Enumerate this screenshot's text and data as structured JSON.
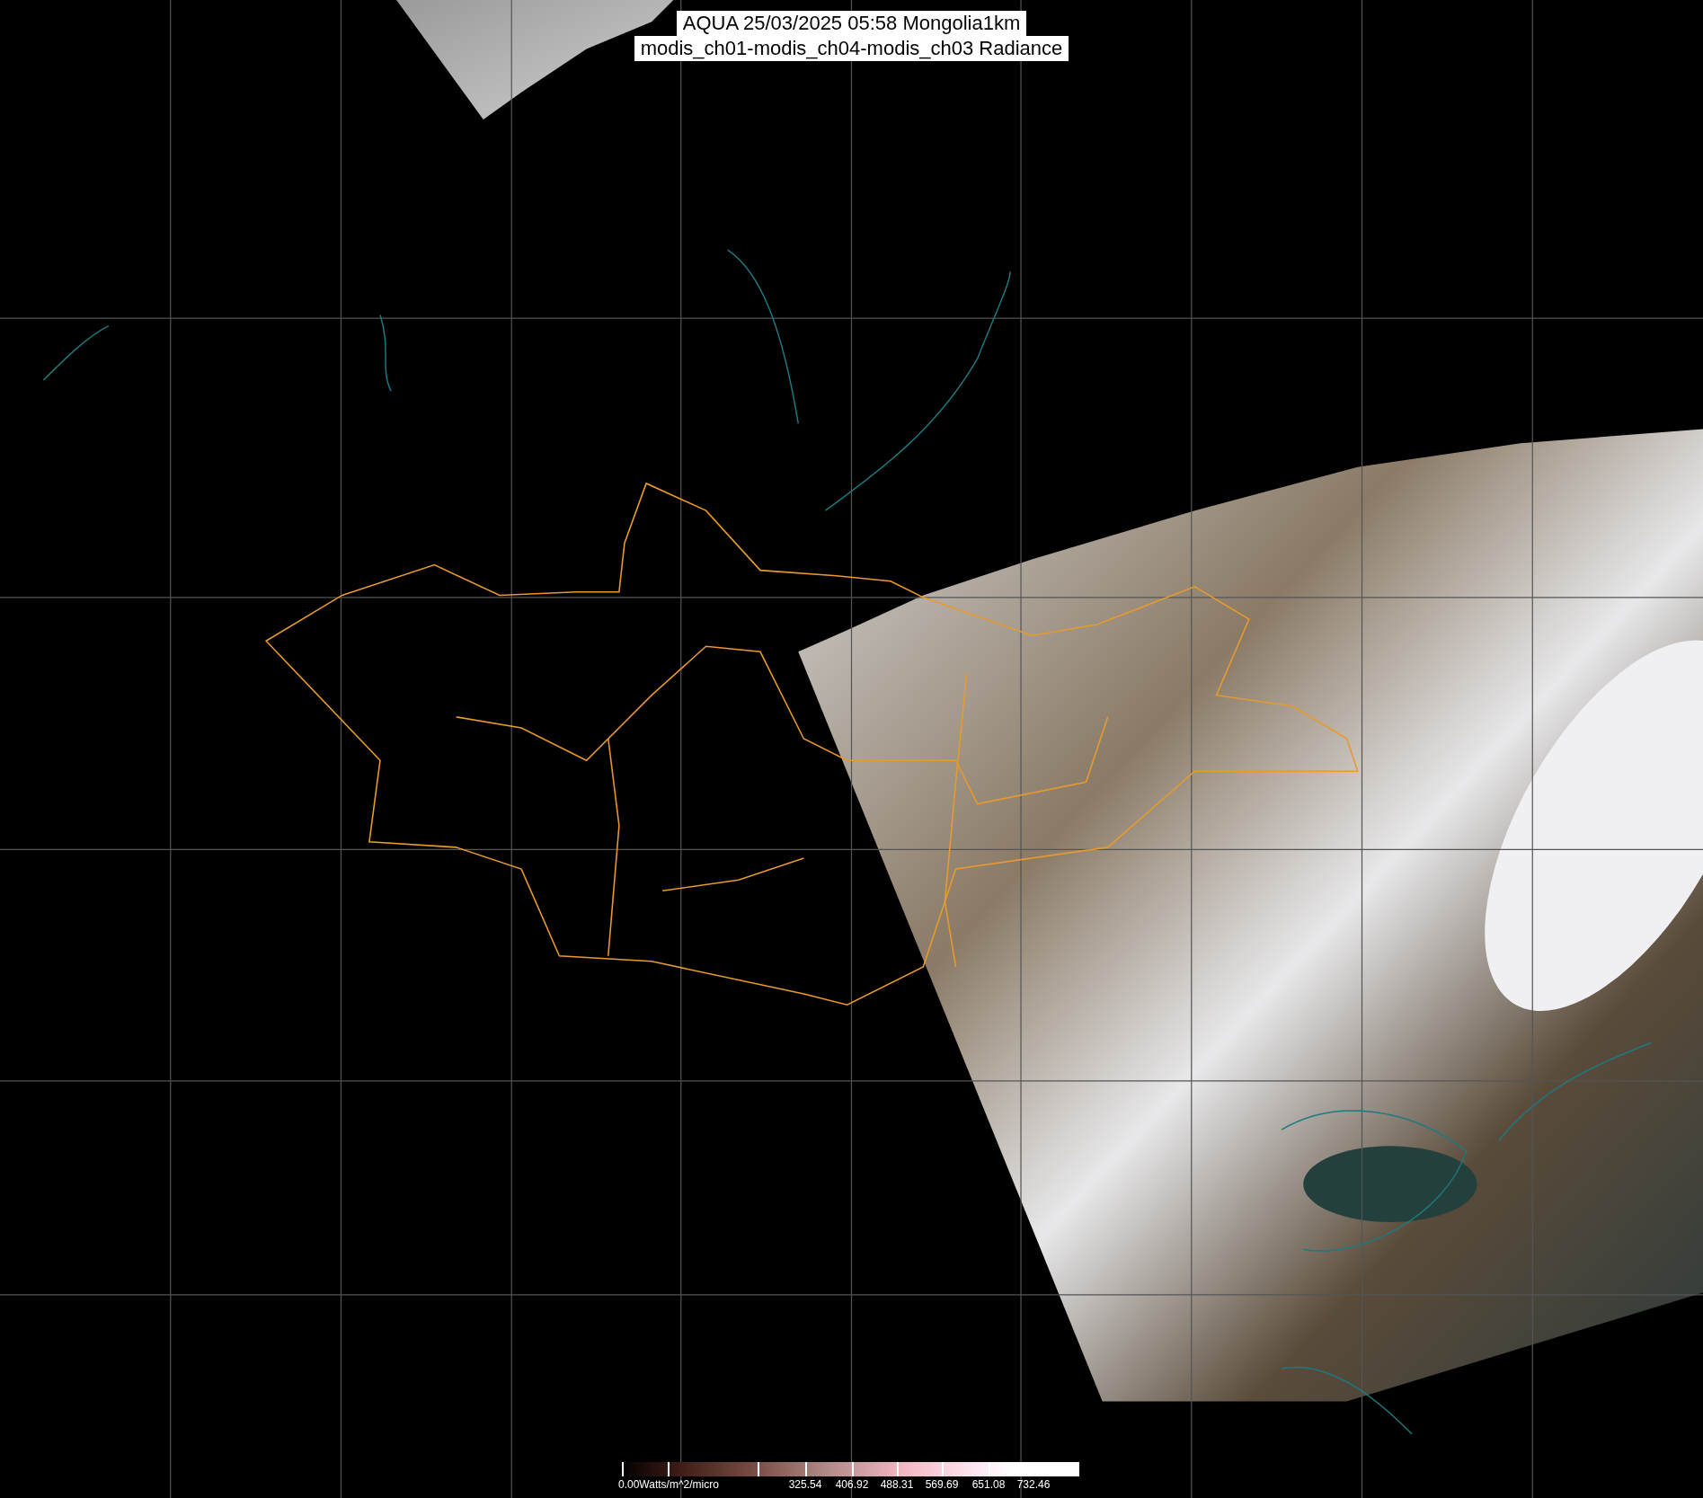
{
  "title": {
    "lines": [
      "AQUA 25/03/2025 05:58 Mongolia1km",
      "modis_ch01-modis_ch04-modis_ch03 Radiance"
    ]
  },
  "colorbar": {
    "labels": [
      "0.00Watts/m^2/micro",
      "325.54",
      "406.92",
      "488.31",
      "569.69",
      "651.08",
      "732.46"
    ]
  }
}
